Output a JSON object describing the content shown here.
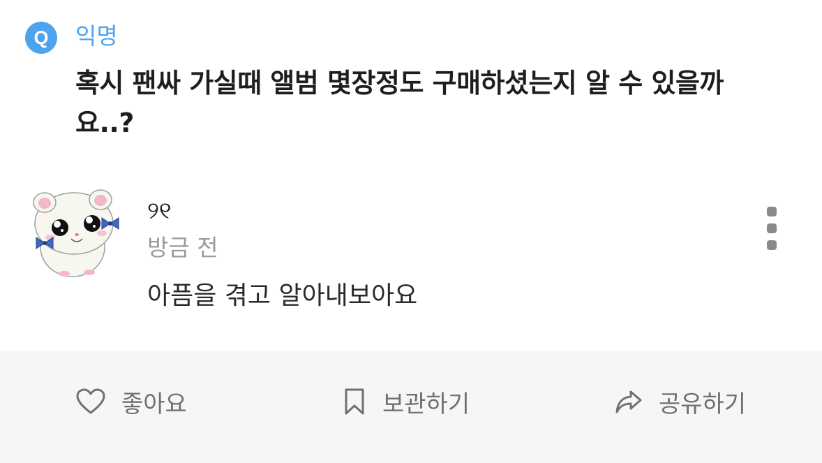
{
  "post": {
    "badge": "Q",
    "board": "익명",
    "title": "혹시 팬싸 가실때 앨범 몇장정도 구매하셨는지 알 수 있을까요..?"
  },
  "comment": {
    "avatar": "hamster-avatar",
    "username": "୨୧",
    "time": "방금 전",
    "text": "아픔을 겪고 알아내보아요"
  },
  "actions": {
    "like_label": "좋아요",
    "save_label": "보관하기",
    "share_label": "공유하기"
  },
  "colors": {
    "accent": "#4da3ee",
    "action_bg": "#f6f6f6",
    "muted": "#9a9a9a"
  }
}
